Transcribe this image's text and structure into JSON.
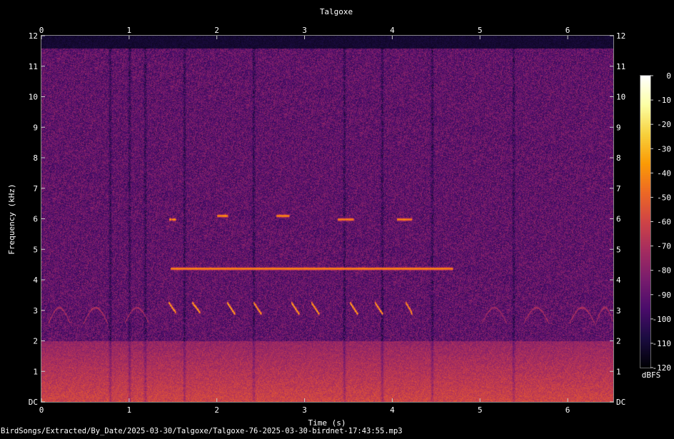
{
  "chart_data": {
    "type": "heatmap",
    "title": "Talgoxe",
    "xlabel": "Time (s)",
    "ylabel": "Frequency (kHz)",
    "xlim": [
      0,
      6.52
    ],
    "ylim": [
      0,
      12
    ],
    "x_ticks": [
      "0",
      "1",
      "2",
      "3",
      "4",
      "5",
      "6"
    ],
    "y_ticks": [
      "DC",
      "1",
      "2",
      "3",
      "4",
      "5",
      "6",
      "7",
      "8",
      "9",
      "10",
      "11",
      "12"
    ],
    "colorbar": {
      "label": "dBFS",
      "range": [
        -120,
        0
      ],
      "ticks": [
        "0",
        "-10",
        "-20",
        "-30",
        "-40",
        "-50",
        "-60",
        "-70",
        "-80",
        "-90",
        "-100",
        "-110",
        "-120"
      ],
      "colormap": "inferno",
      "colors": [
        "#000004",
        "#1b0c41",
        "#4a0c6b",
        "#781c6d",
        "#a52c60",
        "#cf4446",
        "#ed6925",
        "#fb9b06",
        "#f7d13d",
        "#fcffa4",
        "#ffffff"
      ]
    },
    "background_level_dbfs": -90,
    "lowband_level_dbfs": -60,
    "lowband_top_khz": 2,
    "noise_top_khz": 11.6,
    "song_notes": [
      {
        "t": [
          1.47,
          4.68
        ],
        "f_khz": [
          4.38,
          4.38
        ],
        "dbfs": -38
      },
      {
        "t": [
          1.46,
          1.52
        ],
        "f_khz": [
          6.0,
          6.0
        ],
        "dbfs": -35
      },
      {
        "t": [
          2.0,
          2.12
        ],
        "f_khz": [
          6.1,
          6.1
        ],
        "dbfs": -38
      },
      {
        "t": [
          2.68,
          2.82
        ],
        "f_khz": [
          6.1,
          6.1
        ],
        "dbfs": -38
      },
      {
        "t": [
          3.38,
          3.55
        ],
        "f_khz": [
          6.0,
          6.0
        ],
        "dbfs": -40
      },
      {
        "t": [
          4.05,
          4.22
        ],
        "f_khz": [
          6.0,
          6.0
        ],
        "dbfs": -40
      },
      {
        "t": [
          1.45,
          1.52
        ],
        "f_khz": [
          3.25,
          2.95
        ],
        "dbfs": -30
      },
      {
        "t": [
          1.72,
          1.8
        ],
        "f_khz": [
          3.25,
          2.95
        ],
        "dbfs": -30
      },
      {
        "t": [
          2.12,
          2.2
        ],
        "f_khz": [
          3.25,
          2.9
        ],
        "dbfs": -28
      },
      {
        "t": [
          2.42,
          2.5
        ],
        "f_khz": [
          3.25,
          2.9
        ],
        "dbfs": -30
      },
      {
        "t": [
          2.85,
          2.93
        ],
        "f_khz": [
          3.25,
          2.9
        ],
        "dbfs": -28
      },
      {
        "t": [
          3.08,
          3.16
        ],
        "f_khz": [
          3.25,
          2.9
        ],
        "dbfs": -30
      },
      {
        "t": [
          3.52,
          3.6
        ],
        "f_khz": [
          3.25,
          2.9
        ],
        "dbfs": -28
      },
      {
        "t": [
          3.8,
          3.88
        ],
        "f_khz": [
          3.25,
          2.9
        ],
        "dbfs": -30
      },
      {
        "t": [
          4.15,
          4.22
        ],
        "f_khz": [
          3.25,
          2.9
        ],
        "dbfs": -32
      }
    ],
    "arcs": [
      {
        "t": [
          0.08,
          0.32
        ],
        "f_khz": 3.1,
        "dbfs": -65
      },
      {
        "t": [
          0.48,
          0.75
        ],
        "f_khz": 3.1,
        "dbfs": -65
      },
      {
        "t": [
          0.95,
          1.22
        ],
        "f_khz": 3.1,
        "dbfs": -68
      },
      {
        "t": [
          5.02,
          5.3
        ],
        "f_khz": 3.1,
        "dbfs": -70
      },
      {
        "t": [
          5.5,
          5.78
        ],
        "f_khz": 3.1,
        "dbfs": -68
      },
      {
        "t": [
          6.02,
          6.3
        ],
        "f_khz": 3.1,
        "dbfs": -66
      },
      {
        "t": [
          6.32,
          6.52
        ],
        "f_khz": 3.1,
        "dbfs": -66
      }
    ],
    "dark_columns_s": [
      0.78,
      1.0,
      1.18,
      1.63,
      2.42,
      3.45,
      3.88,
      4.45,
      5.38
    ]
  },
  "footer": {
    "file_path": "BirdSongs/Extracted/By_Date/2025-03-30/Talgoxe/Talgoxe-76-2025-03-30-birdnet-17:43:55.mp3"
  }
}
